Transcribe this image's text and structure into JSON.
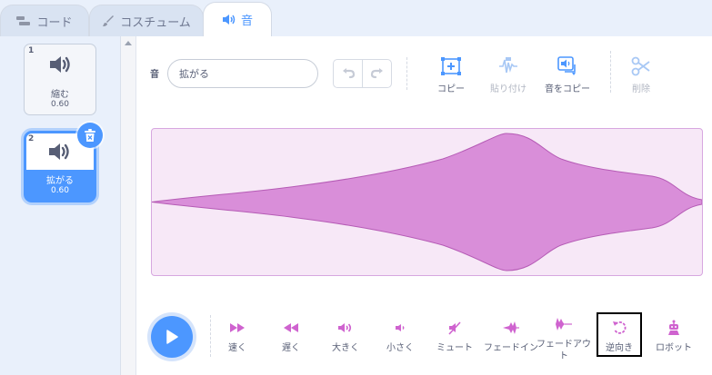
{
  "colors": {
    "accent": "#4c97ff",
    "sound": "#cf63cf",
    "wave_fill": "#d98ed9",
    "wave_bg": "#f7e8f7"
  },
  "tabs": [
    {
      "label": "コード",
      "icon": "code-icon",
      "active": false
    },
    {
      "label": "コスチューム",
      "icon": "brush-icon",
      "active": false
    },
    {
      "label": "音",
      "icon": "speaker-icon",
      "active": true
    }
  ],
  "sounds": [
    {
      "index": "1",
      "name": "縮む",
      "duration": "0.60",
      "selected": false
    },
    {
      "index": "2",
      "name": "拡がる",
      "duration": "0.60",
      "selected": true
    }
  ],
  "editor": {
    "sound_label": "音",
    "sound_name": "拡がる",
    "toolbar": [
      {
        "label": "コピー",
        "icon": "copy-icon",
        "enabled": true
      },
      {
        "label": "貼り付け",
        "icon": "paste-icon",
        "enabled": false
      },
      {
        "label": "音をコピー",
        "icon": "copy-sound-icon",
        "enabled": true
      },
      {
        "label": "削除",
        "icon": "scissors-icon",
        "enabled": false
      }
    ]
  },
  "effects": [
    {
      "label": "速く",
      "icon": "faster-icon"
    },
    {
      "label": "遅く",
      "icon": "slower-icon"
    },
    {
      "label": "大きく",
      "icon": "louder-icon"
    },
    {
      "label": "小さく",
      "icon": "softer-icon"
    },
    {
      "label": "ミュート",
      "icon": "mute-icon"
    },
    {
      "label": "フェードイン",
      "icon": "fade-in-icon"
    },
    {
      "label": "フェードアウト",
      "icon": "fade-out-icon"
    },
    {
      "label": "逆向き",
      "icon": "reverse-icon"
    },
    {
      "label": "ロボット",
      "icon": "robot-icon"
    }
  ]
}
